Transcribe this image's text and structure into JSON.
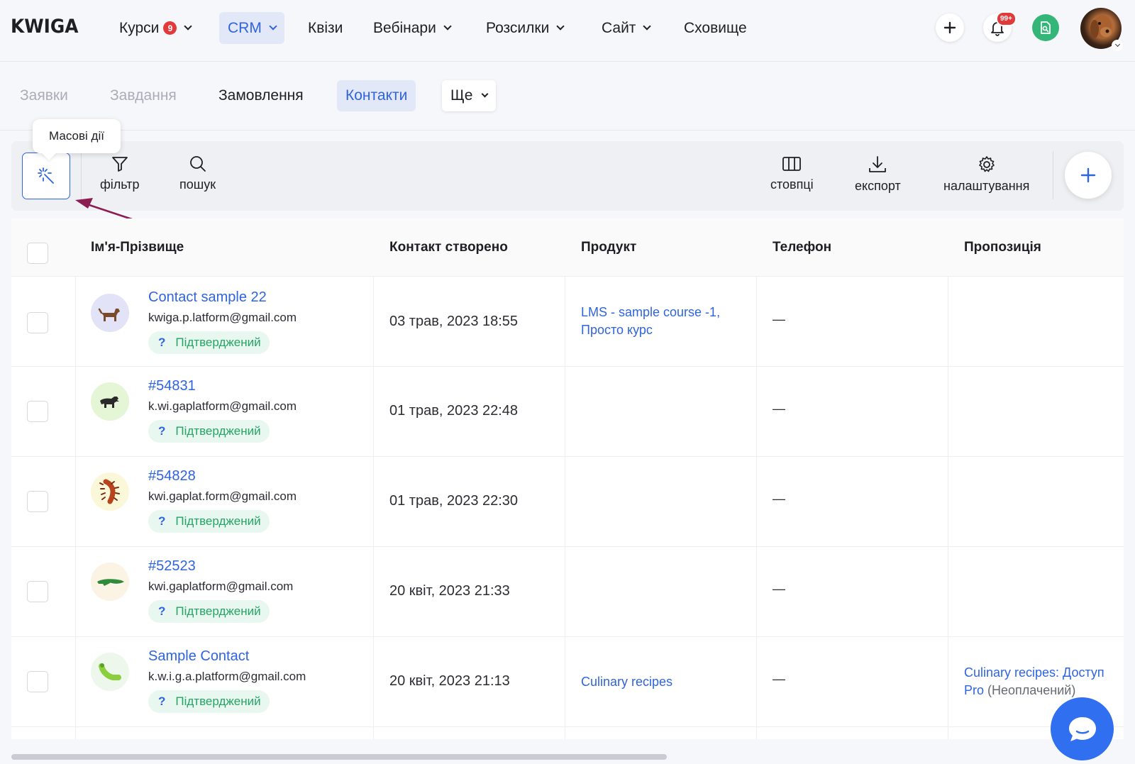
{
  "brand": {
    "logo": "KWIGA"
  },
  "topnav": {
    "items": [
      {
        "label": "Курси",
        "badge": "9"
      },
      {
        "label": "CRM"
      },
      {
        "label": "Квізи"
      },
      {
        "label": "Вебінари"
      },
      {
        "label": "Розсилки"
      },
      {
        "label": "Сайт"
      },
      {
        "label": "Сховище"
      }
    ],
    "notifications_badge": "99+"
  },
  "subnav": {
    "items": [
      {
        "label": "Заявки"
      },
      {
        "label": "Завдання"
      },
      {
        "label": "Замовлення"
      },
      {
        "label": "Контакти"
      },
      {
        "label": "Ще"
      }
    ]
  },
  "toolbar": {
    "tooltip": "Масові дії",
    "filter": "фільтр",
    "search": "пошук",
    "columns": "стовпці",
    "export": "експорт",
    "settings": "налаштування"
  },
  "table": {
    "headers": {
      "name": "Ім'я-Прізвище",
      "created": "Контакт створено",
      "product": "Продукт",
      "phone": "Телефон",
      "offer": "Пропозиція"
    },
    "rows": [
      {
        "name": "Contact sample 22",
        "email": "kwiga.p.latform@gmail.com",
        "status": "Підтверджений",
        "created": "03 трав, 2023 18:55",
        "product": "LMS - sample course -1, Просто курс",
        "phone": "—",
        "offer": "",
        "offer_note": "",
        "avatar_icon": "dog-icon"
      },
      {
        "name": "#54831",
        "email": "k.wi.gaplatform@gmail.com",
        "status": "Підтверджений",
        "created": "01 трав, 2023 22:48",
        "product": "",
        "phone": "—",
        "offer": "",
        "offer_note": "",
        "avatar_icon": "panther-icon"
      },
      {
        "name": "#54828",
        "email": "kwi.gaplat.form@gmail.com",
        "status": "Підтверджений",
        "created": "01 трав, 2023 22:30",
        "product": "",
        "phone": "—",
        "offer": "",
        "offer_note": "",
        "avatar_icon": "centipede-icon"
      },
      {
        "name": "#52523",
        "email": "kwi.gaplatform@gmail.com",
        "status": "Підтверджений",
        "created": "20 квіт, 2023 21:33",
        "product": "",
        "phone": "—",
        "offer": "",
        "offer_note": "",
        "avatar_icon": "crocodile-icon"
      },
      {
        "name": "Sample Contact",
        "email": "k.w.i.g.a.platform@gmail.com",
        "status": "Підтверджений",
        "created": "20 квіт, 2023 21:13",
        "product": "Culinary recipes",
        "phone": "—",
        "offer": "Culinary recipes: Доступ Pro",
        "offer_note": "(Неоплачений)",
        "avatar_icon": "caterpillar-icon"
      }
    ]
  },
  "colors": {
    "accent": "#2f64e0",
    "status_green": "#25a564",
    "badge_red": "#e23a3a",
    "chat_blue": "#2f6ff0"
  }
}
